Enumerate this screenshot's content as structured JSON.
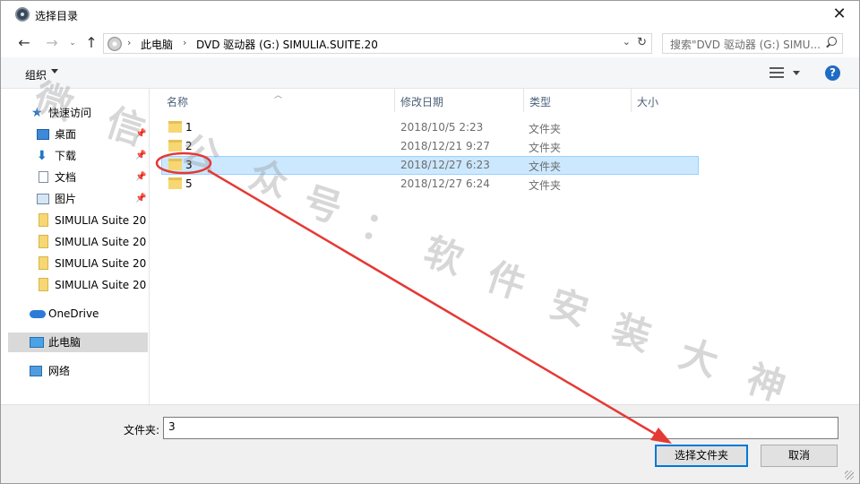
{
  "window": {
    "title": "选择目录"
  },
  "address": {
    "crumbs": [
      "此电脑",
      "DVD 驱动器 (G:) SIMULIA.SUITE.20"
    ]
  },
  "search": {
    "placeholder": "搜索\"DVD 驱动器 (G:) SIMU..."
  },
  "toolbar": {
    "organize": "组织"
  },
  "sidebar": {
    "items": [
      {
        "label": "快速访问",
        "icon": "star-icon"
      },
      {
        "label": "桌面",
        "icon": "desktop-icon",
        "pinned": true
      },
      {
        "label": "下载",
        "icon": "download-icon",
        "pinned": true
      },
      {
        "label": "文档",
        "icon": "document-icon",
        "pinned": true
      },
      {
        "label": "图片",
        "icon": "pictures-icon",
        "pinned": true
      },
      {
        "label": "SIMULIA Suite 20",
        "icon": "folder-icon"
      },
      {
        "label": "SIMULIA Suite 20",
        "icon": "folder-icon"
      },
      {
        "label": "SIMULIA Suite 20",
        "icon": "folder-icon"
      },
      {
        "label": "SIMULIA Suite 20",
        "icon": "folder-icon"
      },
      {
        "label": "OneDrive",
        "icon": "onedrive-icon"
      },
      {
        "label": "此电脑",
        "icon": "this-pc-icon",
        "selected": true
      },
      {
        "label": "网络",
        "icon": "network-icon"
      }
    ]
  },
  "columns": {
    "name": "名称",
    "date": "修改日期",
    "type": "类型",
    "size": "大小"
  },
  "files": [
    {
      "name": "1",
      "date": "2018/10/5 2:23",
      "type": "文件夹"
    },
    {
      "name": "2",
      "date": "2018/12/21 9:27",
      "type": "文件夹"
    },
    {
      "name": "3",
      "date": "2018/12/27 6:23",
      "type": "文件夹",
      "selected": true
    },
    {
      "name": "5",
      "date": "2018/12/27 6:24",
      "type": "文件夹"
    }
  ],
  "footer": {
    "folder_label": "文件夹:",
    "folder_value": "3",
    "select_button": "选择文件夹",
    "cancel_button": "取消"
  },
  "watermark": {
    "chars": [
      "微",
      "信",
      "公",
      "众",
      "号",
      "：",
      "软",
      "件",
      "安",
      "装",
      "大",
      "神"
    ]
  },
  "colors": {
    "selection": "#cce8ff",
    "accent": "#0078d7",
    "annotation": "#e53935"
  }
}
